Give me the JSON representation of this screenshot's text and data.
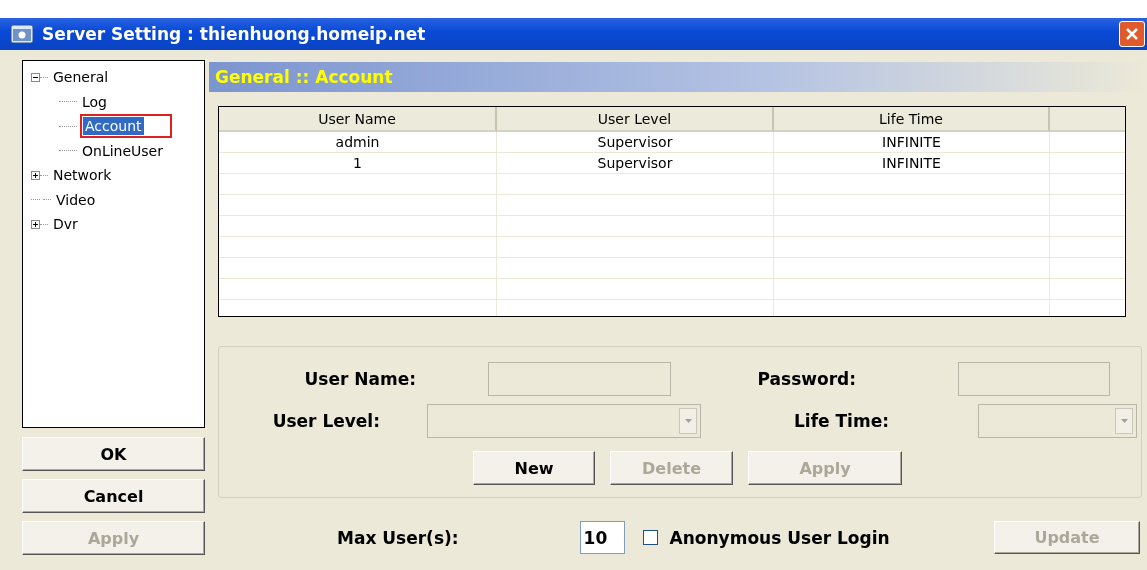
{
  "window": {
    "title": "Server Setting : thienhuong.homeip.net"
  },
  "tree": [
    {
      "label": "General",
      "expanded": true,
      "selected": false,
      "children": [
        {
          "label": "Log",
          "selected": false
        },
        {
          "label": "Account",
          "selected": true
        },
        {
          "label": "OnLineUser",
          "selected": false
        }
      ]
    },
    {
      "label": "Network",
      "expanded": false,
      "selected": false
    },
    {
      "label": "Video",
      "selected": false
    },
    {
      "label": "Dvr",
      "expanded": false,
      "selected": false
    }
  ],
  "dialog_buttons": [
    {
      "label": "OK",
      "disabled": false
    },
    {
      "label": "Cancel",
      "disabled": false
    },
    {
      "label": "Apply",
      "disabled": true
    }
  ],
  "panel_title": "General :: Account",
  "table": {
    "columns": [
      "User Name",
      "User Level",
      "Life Time"
    ],
    "rows": [
      [
        "admin",
        "Supervisor",
        "INFINITE"
      ],
      [
        "1",
        "Supervisor",
        "INFINITE"
      ]
    ]
  },
  "form": {
    "fields": [
      {
        "label": "User Name:",
        "kind": "text",
        "disabled": true
      },
      {
        "label": "Password:",
        "kind": "text",
        "disabled": true
      },
      {
        "label": "User Level:",
        "kind": "select",
        "disabled": true
      },
      {
        "label": "Life Time:",
        "kind": "select",
        "disabled": true
      }
    ],
    "buttons": [
      {
        "label": "New",
        "disabled": false
      },
      {
        "label": "Delete",
        "disabled": true
      },
      {
        "label": "Apply",
        "disabled": true
      }
    ]
  },
  "max_users": {
    "label": "Max User(s):",
    "value": "10"
  },
  "anonymous_login": {
    "label": "Anonymous User Login",
    "checked": false
  },
  "update_button": {
    "label": "Update",
    "disabled": true
  }
}
